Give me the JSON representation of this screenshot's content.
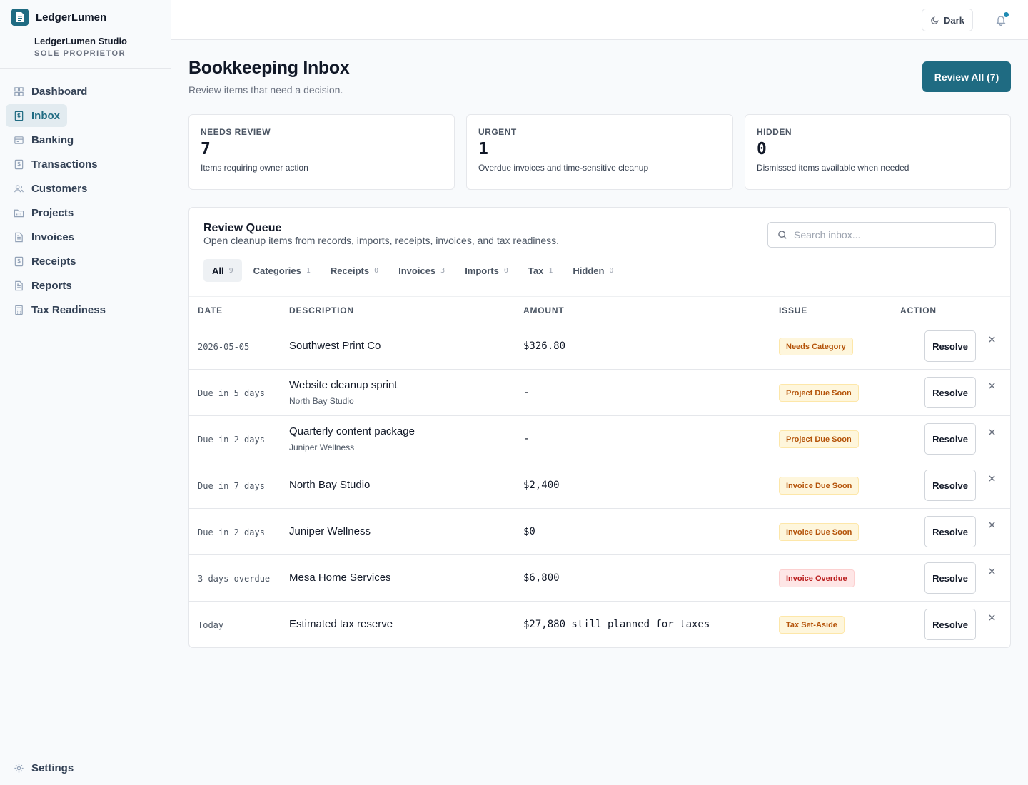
{
  "app": {
    "name": "LedgerLumen",
    "org_name": "LedgerLumen Studio",
    "org_type": "SOLE PROPRIETOR"
  },
  "colors": {
    "accent": "#1f6b82",
    "warning_text": "#b45309",
    "danger_text": "#b91c1c"
  },
  "sidebar": {
    "items": [
      {
        "label": "Dashboard",
        "icon": "grid-icon",
        "active": false
      },
      {
        "label": "Inbox",
        "icon": "dollar-doc-icon",
        "active": true
      },
      {
        "label": "Banking",
        "icon": "bank-icon",
        "active": false
      },
      {
        "label": "Transactions",
        "icon": "dollar-doc-icon",
        "active": false
      },
      {
        "label": "Customers",
        "icon": "users-icon",
        "active": false
      },
      {
        "label": "Projects",
        "icon": "folder-chart-icon",
        "active": false
      },
      {
        "label": "Invoices",
        "icon": "document-icon",
        "active": false
      },
      {
        "label": "Receipts",
        "icon": "dollar-doc-icon",
        "active": false
      },
      {
        "label": "Reports",
        "icon": "document-icon",
        "active": false
      },
      {
        "label": "Tax Readiness",
        "icon": "calculator-icon",
        "active": false
      }
    ],
    "settings_label": "Settings"
  },
  "topbar": {
    "theme_label": "Dark"
  },
  "header": {
    "title": "Bookkeeping Inbox",
    "subtitle": "Review items that need a decision.",
    "review_all_label": "Review All (7)"
  },
  "stats": [
    {
      "label": "NEEDS REVIEW",
      "value": "7",
      "desc": "Items requiring owner action"
    },
    {
      "label": "URGENT",
      "value": "1",
      "desc": "Overdue invoices and time-sensitive cleanup"
    },
    {
      "label": "HIDDEN",
      "value": "0",
      "desc": "Dismissed items available when needed"
    }
  ],
  "queue": {
    "title": "Review Queue",
    "subtitle": "Open cleanup items from records, imports, receipts, invoices, and tax readiness.",
    "search_placeholder": "Search inbox...",
    "tabs": [
      {
        "label": "All",
        "count": "9",
        "active": true
      },
      {
        "label": "Categories",
        "count": "1",
        "active": false
      },
      {
        "label": "Receipts",
        "count": "0",
        "active": false
      },
      {
        "label": "Invoices",
        "count": "3",
        "active": false
      },
      {
        "label": "Imports",
        "count": "0",
        "active": false
      },
      {
        "label": "Tax",
        "count": "1",
        "active": false
      },
      {
        "label": "Hidden",
        "count": "0",
        "active": false
      }
    ],
    "columns": {
      "date": "DATE",
      "description": "DESCRIPTION",
      "amount": "AMOUNT",
      "issue": "ISSUE",
      "action": "ACTION"
    },
    "resolve_label": "Resolve",
    "rows": [
      {
        "date": "2026-05-05",
        "description": "Southwest Print Co",
        "sub": "",
        "amount": "$326.80",
        "issue": "Needs Category",
        "severity": "warn"
      },
      {
        "date": "Due in 5 days",
        "description": "Website cleanup sprint",
        "sub": "North Bay Studio",
        "amount": "-",
        "issue": "Project Due Soon",
        "severity": "warn"
      },
      {
        "date": "Due in 2 days",
        "description": "Quarterly content package",
        "sub": "Juniper Wellness",
        "amount": "-",
        "issue": "Project Due Soon",
        "severity": "warn"
      },
      {
        "date": "Due in 7 days",
        "description": "North Bay Studio",
        "sub": "",
        "amount": "$2,400",
        "issue": "Invoice Due Soon",
        "severity": "warn"
      },
      {
        "date": "Due in 2 days",
        "description": "Juniper Wellness",
        "sub": "",
        "amount": "$0",
        "issue": "Invoice Due Soon",
        "severity": "warn"
      },
      {
        "date": "3 days overdue",
        "description": "Mesa Home Services",
        "sub": "",
        "amount": "$6,800",
        "issue": "Invoice Overdue",
        "severity": "danger"
      },
      {
        "date": "Today",
        "description": "Estimated tax reserve",
        "sub": "",
        "amount": "$27,880 still planned for taxes",
        "issue": "Tax Set-Aside",
        "severity": "warn"
      }
    ]
  }
}
